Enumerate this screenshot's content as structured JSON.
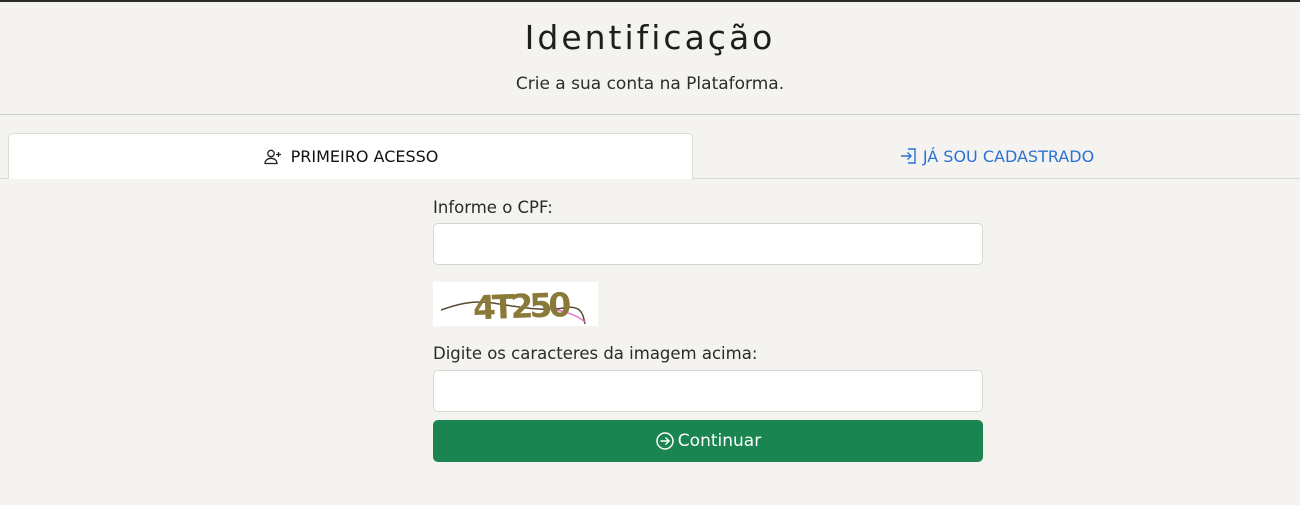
{
  "header": {
    "title": "Identificação",
    "subtitle": "Crie a sua conta na Plataforma."
  },
  "tabs": [
    {
      "label": "PRIMEIRO ACESSO",
      "icon": "user-plus-icon",
      "active": true
    },
    {
      "label": "JÁ SOU CADASTRADO",
      "icon": "login-icon",
      "active": false
    }
  ],
  "form": {
    "cpf_label": "Informe o CPF:",
    "cpf_value": "",
    "captcha_label": "Digite os caracteres da imagem acima:",
    "captcha_value": "",
    "captcha_image_text": "4T250",
    "submit_label": "Continuar",
    "submit_icon": "arrow-right-circle-icon"
  },
  "colors": {
    "accent_green": "#1a8551",
    "link_blue": "#2a72d6",
    "background": "#f4f3ef"
  }
}
